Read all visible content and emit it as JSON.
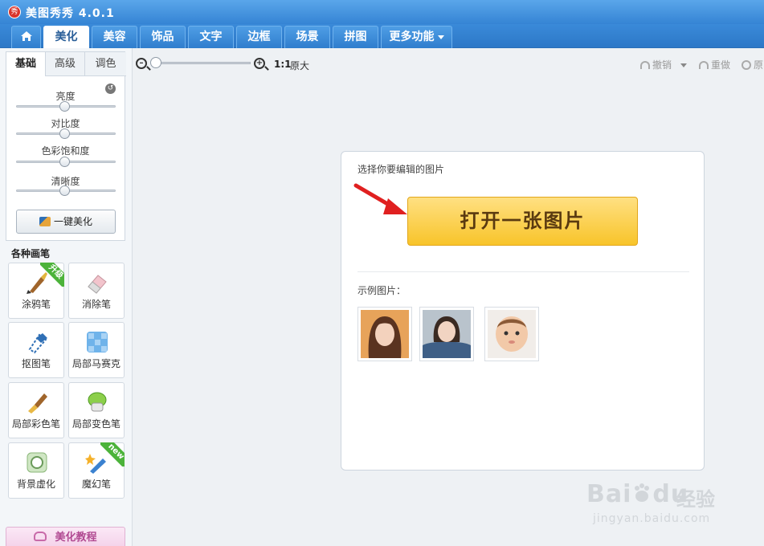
{
  "app": {
    "title": "美图秀秀 4.0.1",
    "logo_text": "秀"
  },
  "tabs": [
    {
      "label": "美化",
      "active": true
    },
    {
      "label": "美容"
    },
    {
      "label": "饰品"
    },
    {
      "label": "文字"
    },
    {
      "label": "边框"
    },
    {
      "label": "场景"
    },
    {
      "label": "拼图"
    },
    {
      "label": "更多功能"
    }
  ],
  "basic_panel": {
    "subtabs": [
      "基础",
      "高级",
      "调色"
    ],
    "sliders": [
      {
        "label": "亮度",
        "value": 0.5
      },
      {
        "label": "对比度",
        "value": 0.5
      },
      {
        "label": "色彩饱和度",
        "value": 0.5
      },
      {
        "label": "清晰度",
        "value": 0.5
      }
    ],
    "onekey_label": "一键美化"
  },
  "brushes": {
    "title": "各种画笔",
    "items": [
      {
        "label": "涂鸦笔",
        "badge": "升级"
      },
      {
        "label": "消除笔"
      },
      {
        "label": "抠图笔"
      },
      {
        "label": "局部马赛克"
      },
      {
        "label": "局部彩色笔"
      },
      {
        "label": "局部变色笔"
      },
      {
        "label": "背景虚化"
      },
      {
        "label": "魔幻笔",
        "badge": "new"
      }
    ]
  },
  "tutorial_label": "美化教程",
  "toolbar": {
    "zoom_ratio": "1:1",
    "zoom_original": "原大",
    "zoom_value": 0.0,
    "undo": "撤销",
    "redo": "重做",
    "original": "原"
  },
  "card": {
    "prompt": "选择你要编辑的图片",
    "open_button": "打开一张图片",
    "sample_label": "示例图片："
  },
  "watermark": {
    "brand": "Bai",
    "brand2": "du",
    "jy": "经验",
    "url": "jingyan.baidu.com"
  },
  "colors": {
    "accent": "#3584d4",
    "open_button": "#f8c42a",
    "arrow": "#e02020"
  }
}
